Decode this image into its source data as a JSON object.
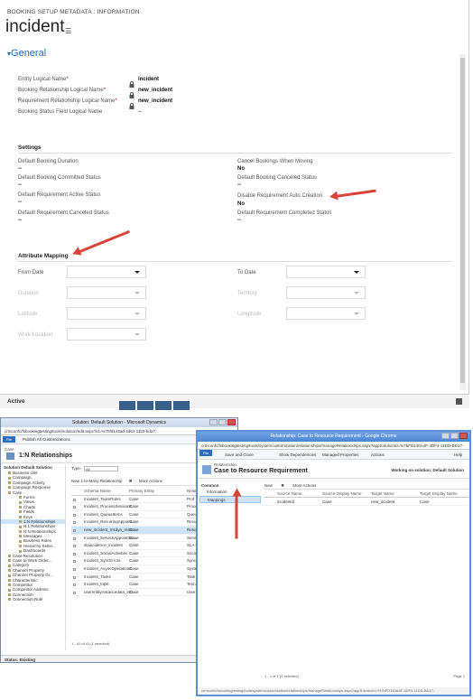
{
  "form": {
    "breadcrumb": "BOOKING SETUP METADATA : INFORMATION",
    "title": "incident",
    "section_general": "General",
    "fields": [
      {
        "label": "Entity Logical Name",
        "value": "incident"
      },
      {
        "label": "Booking Relationship Logical Name",
        "value": "new_incident"
      },
      {
        "label": "Requirement Relationship Logical Name",
        "value": "new_incident"
      },
      {
        "label": "Booking Status Field Logical Name",
        "value": "--"
      }
    ],
    "settings_heading": "Settings",
    "settings_left": [
      {
        "label": "Default Booking Duration",
        "value": "--"
      },
      {
        "label": "Default Booking Committed Status",
        "value": "--"
      },
      {
        "label": "Default Requirement Active Status",
        "value": "--"
      },
      {
        "label": "Default Requirement Canceled Status",
        "value": "--"
      }
    ],
    "settings_right": [
      {
        "label": "Cancel Bookings When Moving",
        "value": "No"
      },
      {
        "label": "Default Booking Canceled Status",
        "value": "--"
      },
      {
        "label": "Disable Requirement Auto Creation",
        "value": "No"
      },
      {
        "label": "Default Requirement Completed Status",
        "value": "--"
      }
    ],
    "mapping_heading": "Attribute Mapping",
    "mapping": {
      "from_date": "From Date",
      "to_date": "To Date",
      "duration": "Duration",
      "territory": "Territory",
      "latitude": "Latitude",
      "longitude": "Longitude",
      "work_location": "Work Location"
    },
    "status": "Active"
  },
  "win1": {
    "title": "Solution: Default Solution - Microsoft Dynamics",
    "address": "crmconfc/fsbookingtesting/tools/solution/edit.aspx?id=%7bfd143ad-4d64-11b0-bd17-",
    "file": "File",
    "publish": "Publish All Customizations",
    "header_small": "Case",
    "header_title": "1:N Relationships",
    "side_heading": "Solution Default Solution",
    "side_items": [
      "Business Unit",
      "Campaign",
      "Campaign Activity",
      "Campaign Response",
      "Case"
    ],
    "side_sub": [
      "Forms",
      "Views",
      "Charts",
      "Fields",
      "Keys",
      "1:N Relationships",
      "N:1 Relationships",
      "N:N Relationships",
      "Messages",
      "Business Rules",
      "Hierarchy Settin...",
      "Dashboards"
    ],
    "side_items2": [
      "Case Resolution",
      "Case to Work Order...",
      "Category",
      "Channel Property",
      "Channel Property Gr...",
      "Characteristic",
      "Competitor",
      "Competitor Address",
      "Connection",
      "Connection Role"
    ],
    "type_label": "Type:",
    "type_value": "All",
    "tool_new": "New 1-to-Many Relationship",
    "tool_more": "More Actions",
    "columns": [
      "Schema Name",
      "Primary Entity",
      "Related"
    ],
    "rows": [
      [
        "Incident_TeamRoles",
        "Case",
        "Prof"
      ],
      [
        "Incident_ProcessSessions",
        "Case",
        "Proce"
      ],
      [
        "Incident_QueueItems",
        "Case",
        "Queu"
      ],
      [
        "Incident_RecurringAppoint...",
        "Case",
        "Recur"
      ],
      [
        "new_incident_msdyn_resou...",
        "Case",
        "Reso"
      ],
      [
        "Incident_ServiceAppointme...",
        "Case",
        "Servi"
      ],
      [
        "slaincidence_incident",
        "Case",
        "SLA K"
      ],
      [
        "Incident_SocialActivities",
        "Case",
        "Social"
      ],
      [
        "Incident_SyncErrors",
        "Case",
        "Sync E"
      ],
      [
        "Incident_AsyncOperations",
        "Case",
        "Syste"
      ],
      [
        "Incident_Tasks",
        "Case",
        "Task"
      ],
      [
        "Incident_topic",
        "Case",
        "Text A"
      ],
      [
        "userentityinstancedata_inci...",
        "Case",
        "User E"
      ]
    ],
    "footer": "1 - 41 of 41 (1 selected)",
    "status": "Status: Existing"
  },
  "win2": {
    "title": "Relationship: Case to Resource Requirement - Google Chrome",
    "address": "crmconfc/fsbookingtesting/tools/systemcustomization/relationships/manageRelationships.aspx?appSolutionId=%7bFD140A4F-4DF4-11DD-BD17-",
    "file": "File",
    "save_close": "Save and Close",
    "show_deps": "Show Dependencies",
    "managed": "Managed Properties",
    "actions": "Actions",
    "help": "Help",
    "header_small": "Relationship",
    "header_title": "Case to Resource Requirement",
    "working_on": "Working on solution: Default Solution",
    "side_heading": "Common",
    "side_items": [
      "Information",
      "Mappings"
    ],
    "tool_new": "New",
    "tool_more": "More Actions",
    "columns": [
      "Source Name",
      "Source Display Name",
      "Target Name",
      "Target Display Name"
    ],
    "rows": [
      [
        "incidentid",
        "Case",
        "new_incident",
        "Case"
      ]
    ],
    "footer": "1 - 1 of 1 (0 selected)",
    "page": "Page 1",
    "url_bar": "crmconfc/fsbookingtesting/tools/systemcustomization/relationships/manageRelationships.aspx?appSolutionId=%7bFD140A4F-4DF4-11DD-BD17-"
  },
  "colors": {
    "accent": "#1f6cb3",
    "arrow": "#d9443a",
    "chrome_title": "#4f86cf"
  }
}
